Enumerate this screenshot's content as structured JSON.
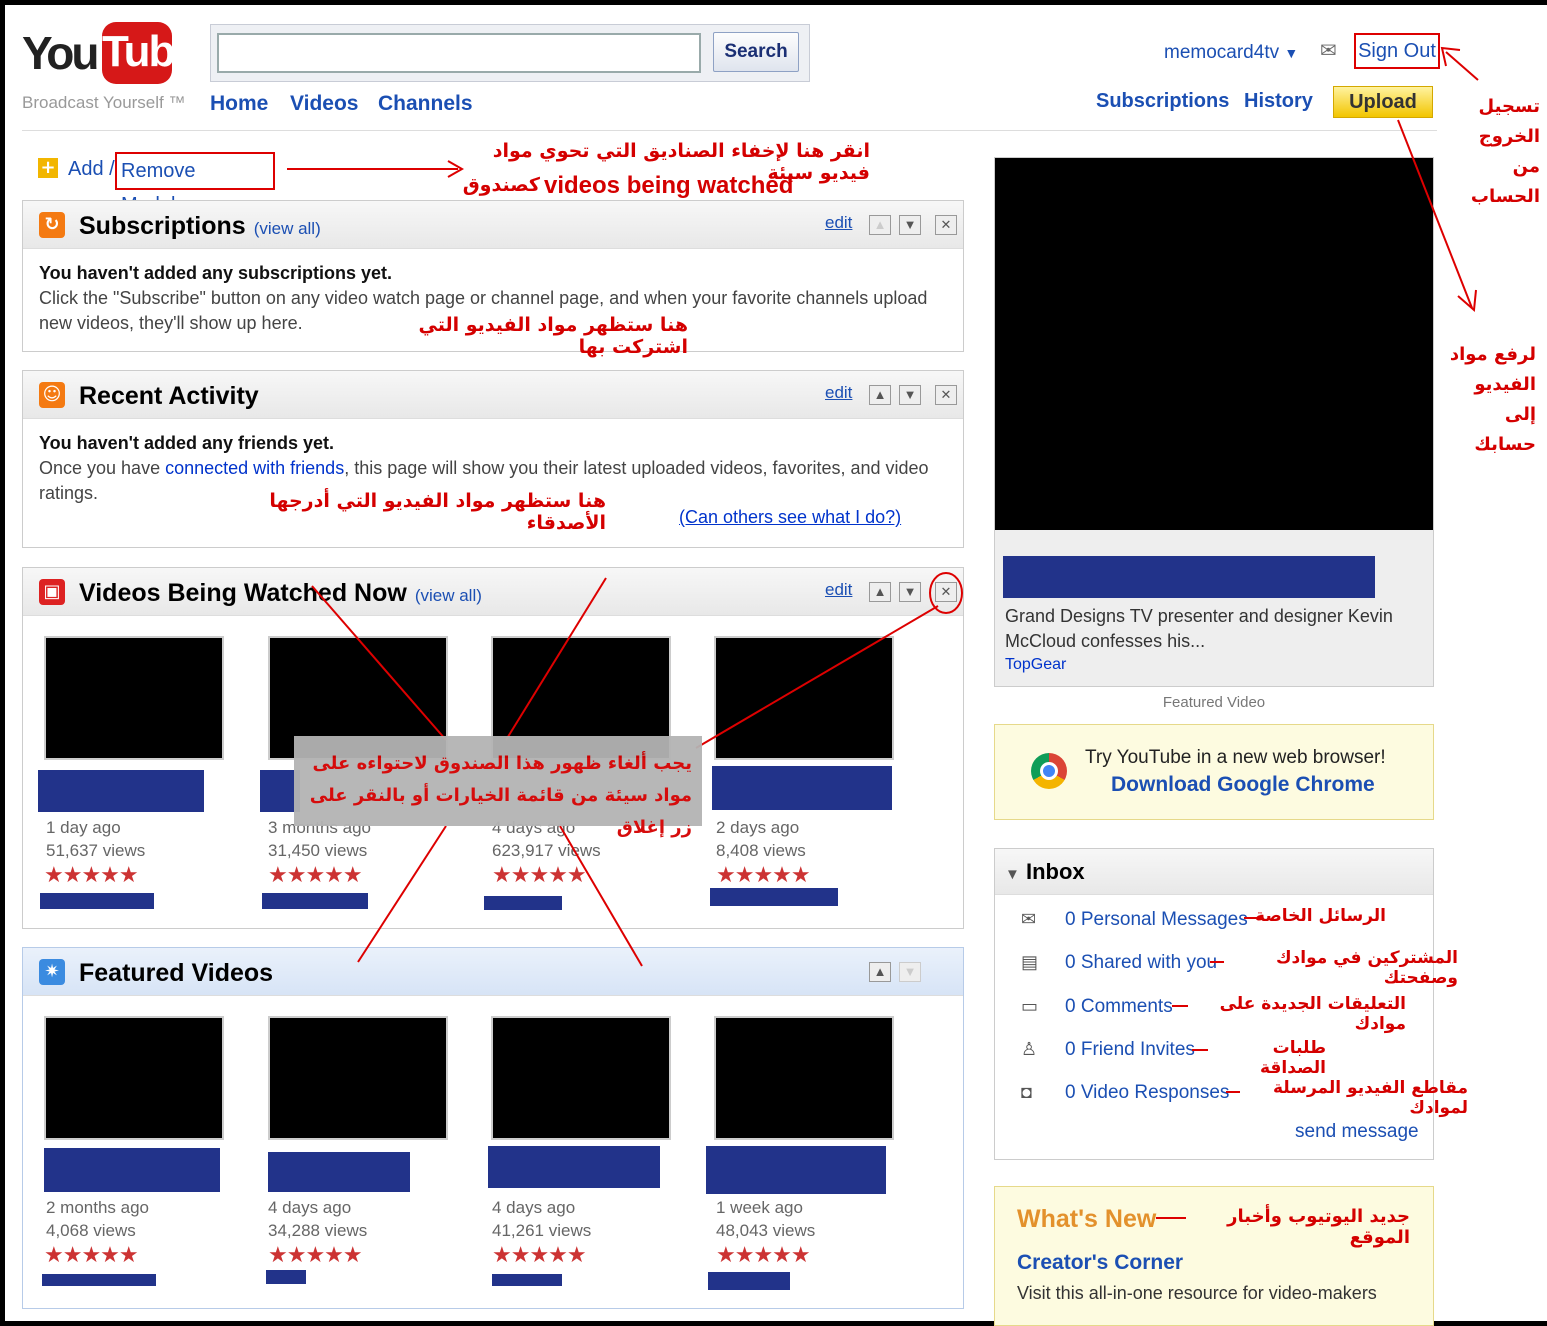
{
  "header": {
    "logo_you": "You",
    "logo_tube": "Tube",
    "tagline": "Broadcast Yourself ™",
    "search_value": "",
    "search_button": "Search",
    "nav": [
      "Home",
      "Videos",
      "Channels"
    ],
    "user": "memocard4tv",
    "sign_out": "Sign Out",
    "subscriptions": "Subscriptions",
    "history": "History",
    "upload": "Upload"
  },
  "annotations": {
    "signout_ar": "تسجيل الخروج من الحساب",
    "upload_ar": "لرفع مواد الفيديو إلى حسابك",
    "modules_ar": "انقر هنا لإخفاء الصناديق التي تحوي مواد فيديو سيئة",
    "modules_ar2": "كصندوق",
    "modules_en": "videos being watched",
    "subs_ar": "هنا ستظهر مواد الفيديو التي اشتركت بها",
    "friends_ar": "هنا ستظهر مواد الفيديو التي أدرجها الأصدقاء",
    "cancel_ar": "يجب ألغاء ظهور هذا الصندوق لاحتواءه على مواد سيئة من قائمة الخيارات أو بالنقر على زر إغلاق",
    "inbox_ar": [
      "الرسائل الخاصة",
      "المشتركين في موادك وصفحتك",
      "التعليقات الجديدة على موادك",
      "طلبات الصداقة",
      "مقاطع الفيديو المرسلة لموادك"
    ],
    "whatsnew_ar": "جديد اليوتيوب وأخبار الموقع"
  },
  "modules_link": {
    "add": "Add /",
    "remove": "Remove Modules"
  },
  "subscriptions": {
    "title": "Subscriptions",
    "view_all": "(view all)",
    "edit": "edit",
    "empty_title": "You haven't added any subscriptions yet.",
    "empty_text": "Click the \"Subscribe\" button on any video watch page or channel page, and when your favorite channels upload new videos, they'll show up here."
  },
  "recent": {
    "title": "Recent Activity",
    "edit": "edit",
    "empty_title": "You haven't added any friends yet.",
    "text_pre": "Once you have",
    "text_link": "connected with friends",
    "text_post": ", this page will show you their latest uploaded videos, favorites, and video ratings.",
    "can_others": "(Can others see what I do?)"
  },
  "watched": {
    "title": "Videos Being Watched Now",
    "view_all": "(view all)",
    "edit": "edit",
    "videos": [
      {
        "age": "1 day ago",
        "views": "51,637 views",
        "stars": "★★★★★"
      },
      {
        "age": "3 months ago",
        "views": "31,450 views",
        "stars": "★★★★★"
      },
      {
        "age": "4 days ago",
        "views": "623,917 views",
        "stars": "★★★★★"
      },
      {
        "age": "2 days ago",
        "views": "8,408 views",
        "stars": "★★★★★"
      }
    ]
  },
  "featured": {
    "title": "Featured Videos",
    "videos": [
      {
        "age": "2 months ago",
        "views": "4,068 views",
        "stars": "★★★★★"
      },
      {
        "age": "4 days ago",
        "views": "34,288 views",
        "stars": "★★★★★"
      },
      {
        "age": "4 days ago",
        "views": "41,261 views",
        "stars": "★★★★★"
      },
      {
        "age": "1 week ago",
        "views": "48,043 views",
        "stars": "★★★★★"
      }
    ]
  },
  "player": {
    "description": "Grand Designs TV presenter and designer Kevin McCloud confesses his...",
    "channel": "TopGear",
    "caption": "Featured Video"
  },
  "chrome": {
    "line1": "Try YouTube in a new web browser!",
    "line2": "Download Google Chrome"
  },
  "inbox": {
    "title": "Inbox",
    "items": [
      "0 Personal Messages",
      "0 Shared with you",
      "0 Comments",
      "0 Friend Invites",
      "0 Video Responses"
    ],
    "send": "send message"
  },
  "whatsnew": {
    "title": "What's New",
    "link": "Creator's Corner",
    "text": "Visit this all-in-one resource for video-makers"
  }
}
